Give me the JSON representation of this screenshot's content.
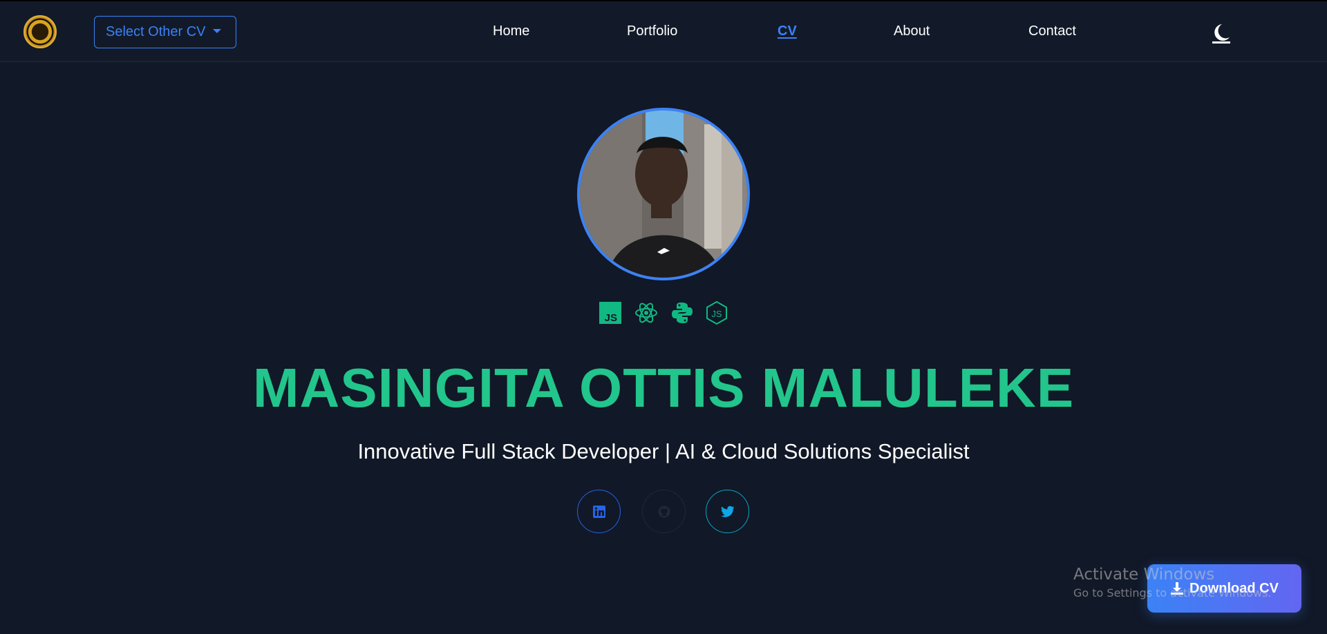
{
  "navbar": {
    "logo_icon": "lion-logo-icon",
    "select_cv_label": "Select Other CV",
    "links": [
      {
        "label": "Home"
      },
      {
        "label": "Portfolio"
      },
      {
        "label": "CV",
        "active": true
      },
      {
        "label": "About"
      },
      {
        "label": "Contact"
      }
    ],
    "theme_toggle_icon": "moon-icon"
  },
  "hero": {
    "avatar_icon": "profile-photo",
    "tech_icons": [
      "javascript-icon",
      "react-icon",
      "python-icon",
      "nodejs-icon"
    ],
    "name": "MASINGITA OTTIS MALULEKE",
    "tagline": "Innovative Full Stack Developer | AI & Cloud Solutions Specialist",
    "social": [
      "linkedin-icon",
      "github-icon",
      "twitter-icon"
    ]
  },
  "download_button": {
    "label": "Download CV",
    "icon": "download-icon"
  },
  "os_watermark": {
    "line1": "Activate Windows",
    "line2": "Go to Settings to activate Windows."
  },
  "colors": {
    "background": "#111827",
    "accent_blue": "#3b82f6",
    "name_green": "#22c58b",
    "icon_green": "#10b981"
  }
}
